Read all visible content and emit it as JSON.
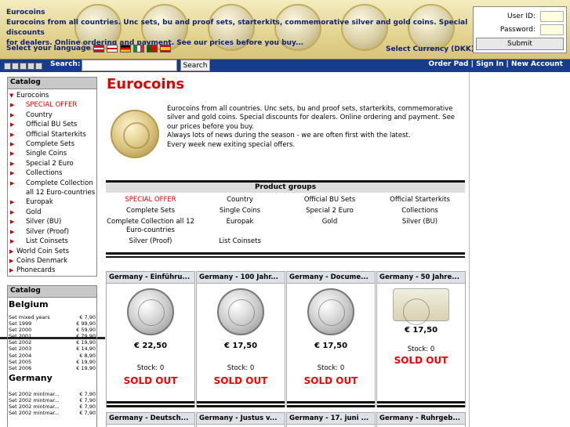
{
  "brand": {
    "title": "Eurocoins",
    "tagline_1": "Eurocoins from all countries. Unc sets, bu and proof sets, starterkits, commemorative silver and gold coins. Special discounts",
    "tagline_2": "for dealers. Online ordering and payment. See our prices before you buy..."
  },
  "header": {
    "select_language": "Select your language",
    "select_currency": "Select Currency (DKK)",
    "flags": [
      "denmark",
      "uk",
      "germany",
      "italy",
      "portugal",
      "spain"
    ]
  },
  "login": {
    "user_id_label": "User ID:",
    "password_label": "Password:",
    "submit_label": "Submit"
  },
  "navbar": {
    "search_label": "Search:",
    "search_button": "Search",
    "order_pad": "Order Pad",
    "sign_in": "Sign In",
    "new_account": "New Account",
    "sep": "|"
  },
  "catalog": {
    "heading": "Catalog",
    "root": "Eurocoins",
    "items": [
      "SPECIAL OFFER",
      "Country",
      "Official BU Sets",
      "Official Starterkits",
      "Complete Sets",
      "Single Coins",
      "Special 2 Euro",
      "Collections",
      "Complete Collection all 12 Euro-countries",
      "Europak",
      "Gold",
      "Silver (BU)",
      "Silver (Proof)",
      "List Coinsets"
    ],
    "other": [
      "World Coin Sets",
      "Coins Denmark",
      "Phonecards"
    ]
  },
  "catalog2": {
    "heading": "Catalog",
    "country1": "Belgium",
    "belgium": [
      [
        "Set mixed years",
        "€ 7,90"
      ],
      [
        "Set 1999",
        "€ 99,90"
      ],
      [
        "Set 2000",
        "€ 59,90"
      ],
      [
        "Set 2001",
        "€ 79,90"
      ],
      [
        "Set 2002",
        "€ 19,90"
      ],
      [
        "Set 2003",
        "€ 14,90"
      ],
      [
        "Set 2004",
        "€ 8,90"
      ],
      [
        "Set 2005",
        "€ 19,90"
      ],
      [
        "Set 2006",
        "€ 19,90"
      ]
    ],
    "country2": "Germany",
    "germany": [
      [
        "Set 2002 mintmar...",
        "€ 7,90"
      ],
      [
        "Set 2002 mintmar...",
        "€ 7,90"
      ],
      [
        "Set 2002 mintmar...",
        "€ 7,90"
      ],
      [
        "Set 2002 mintmar...",
        "€ 7,90"
      ]
    ]
  },
  "main": {
    "title": "Eurocoins",
    "intro": [
      "Eurocoins from all countries. Unc sets, bu and proof sets, starterkits, commemorative silver and gold coins. Special discounts for dealers. Online ordering and payment. See our prices before you buy.",
      "Always lots of news during the season - we are often first with the latest.",
      "Every week new exiting special offers."
    ]
  },
  "product_groups": {
    "heading": "Product groups",
    "items": [
      "SPECIAL OFFER",
      "Country",
      "Official BU Sets",
      "Official Starterkits",
      "Complete Sets",
      "Single Coins",
      "Special 2 Euro",
      "Collections",
      "Complete Collection all 12 Euro-countries",
      "Europak",
      "Gold",
      "Silver (BU)",
      "Silver (Proof)",
      "List Coinsets"
    ]
  },
  "products": [
    {
      "title": "Germany - Einführu...",
      "price": "€ 22,50",
      "stock": "Stock: 0",
      "status": "SOLD OUT"
    },
    {
      "title": "Germany - 100 Jahr...",
      "price": "€ 17,50",
      "stock": "Stock: 0",
      "status": "SOLD OUT"
    },
    {
      "title": "Germany - Docume...",
      "price": "€ 17,50",
      "stock": "Stock: 0",
      "status": "SOLD OUT"
    },
    {
      "title": "Germany - 50 Jahre...",
      "price": "€ 17,50",
      "stock": "Stock: 0",
      "status": "SOLD OUT"
    }
  ],
  "products_row2": [
    {
      "title": "Germany - Deutsch..."
    },
    {
      "title": "Germany - Justus v..."
    },
    {
      "title": "Germany - 17. juni ..."
    },
    {
      "title": "Germany - Ruhrgeb..."
    }
  ],
  "colors": {
    "brand_blue": "#0c2272",
    "nav_blue": "#183c8c",
    "accent_red": "#dd0000"
  }
}
